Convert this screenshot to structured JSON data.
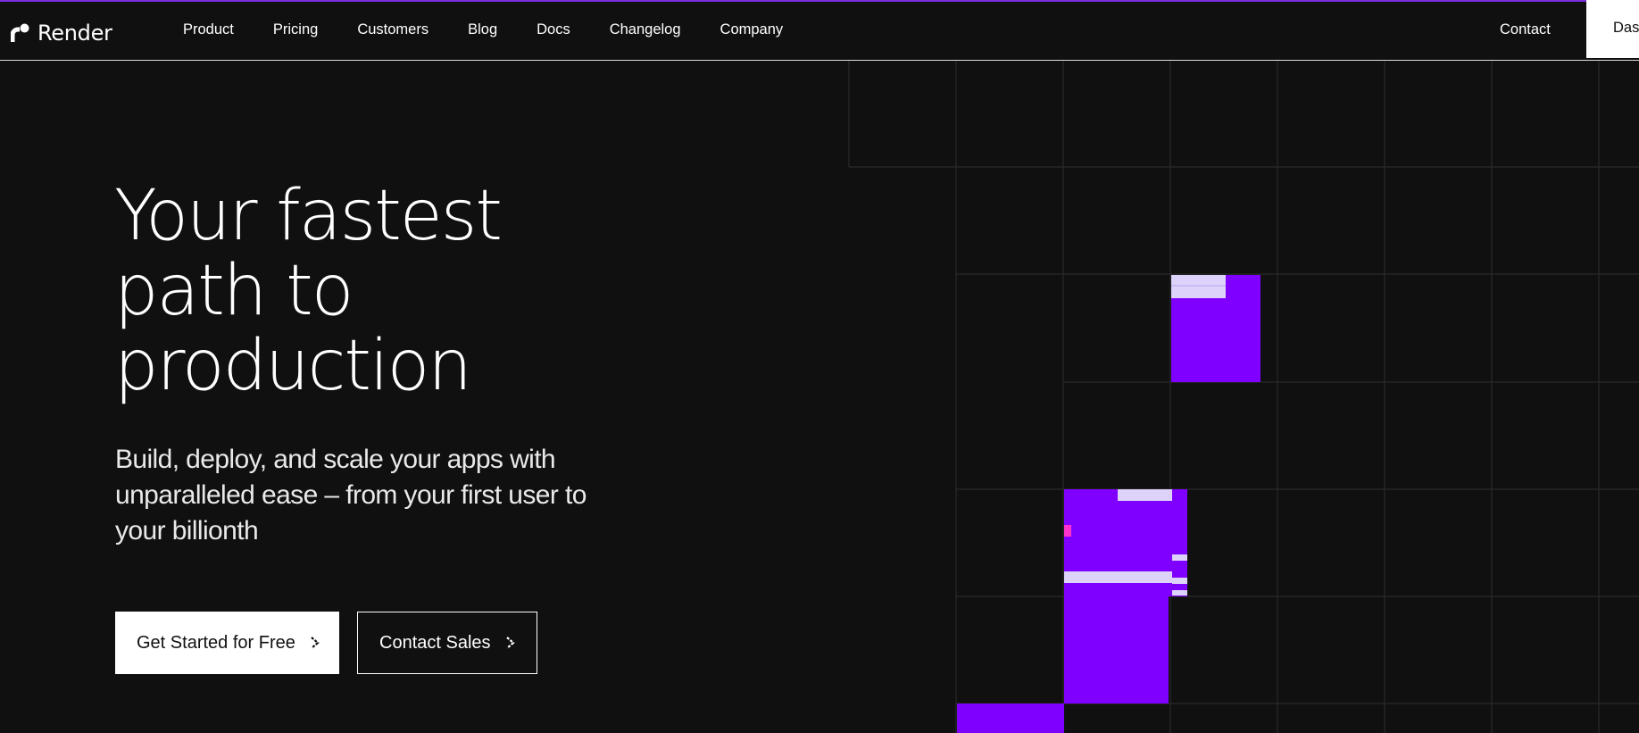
{
  "brand": {
    "name": "Render",
    "accent": "#8000ff",
    "accent_light": "#dcd2fa"
  },
  "nav": {
    "items": [
      "Product",
      "Pricing",
      "Customers",
      "Blog",
      "Docs",
      "Changelog",
      "Company"
    ],
    "contact": "Contact",
    "dashboard": "Dashboard"
  },
  "hero": {
    "title_lines": [
      "Your fastest",
      "path to",
      "production"
    ],
    "subtitle": "Build, deploy, and scale your apps with unparalleled ease – from your first user to your billionth",
    "primary_cta": "Get Started for Free",
    "secondary_cta": "Contact Sales",
    "cta_icon": "chevron-right-icon"
  }
}
